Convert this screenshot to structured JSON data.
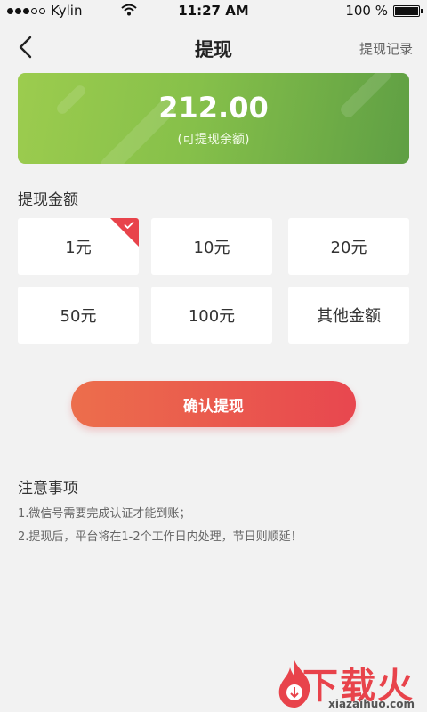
{
  "status_bar": {
    "carrier": "Kylin",
    "time": "11:27 AM",
    "battery": "100 %",
    "battery_level": 1.0
  },
  "nav": {
    "title": "提现",
    "right_link": "提现记录"
  },
  "balance": {
    "amount": "212.00",
    "caption": "(可提现余额)"
  },
  "amount_section": {
    "label": "提现金额",
    "options": [
      "1元",
      "10元",
      "20元",
      "50元",
      "100元",
      "其他金额"
    ],
    "selected_index": 0
  },
  "confirm_button": "确认提现",
  "notes": {
    "title": "注意事项",
    "items": [
      "1.微信号需要完成认证才能到账；",
      "2.提现后，平台将在1-2个工作日内处理，节日则顺延！"
    ]
  },
  "watermark": {
    "brand": "下载火",
    "url": "xiazaihuo.com"
  },
  "colors": {
    "accent": "#e8434b",
    "card_green": "#86c04a"
  }
}
